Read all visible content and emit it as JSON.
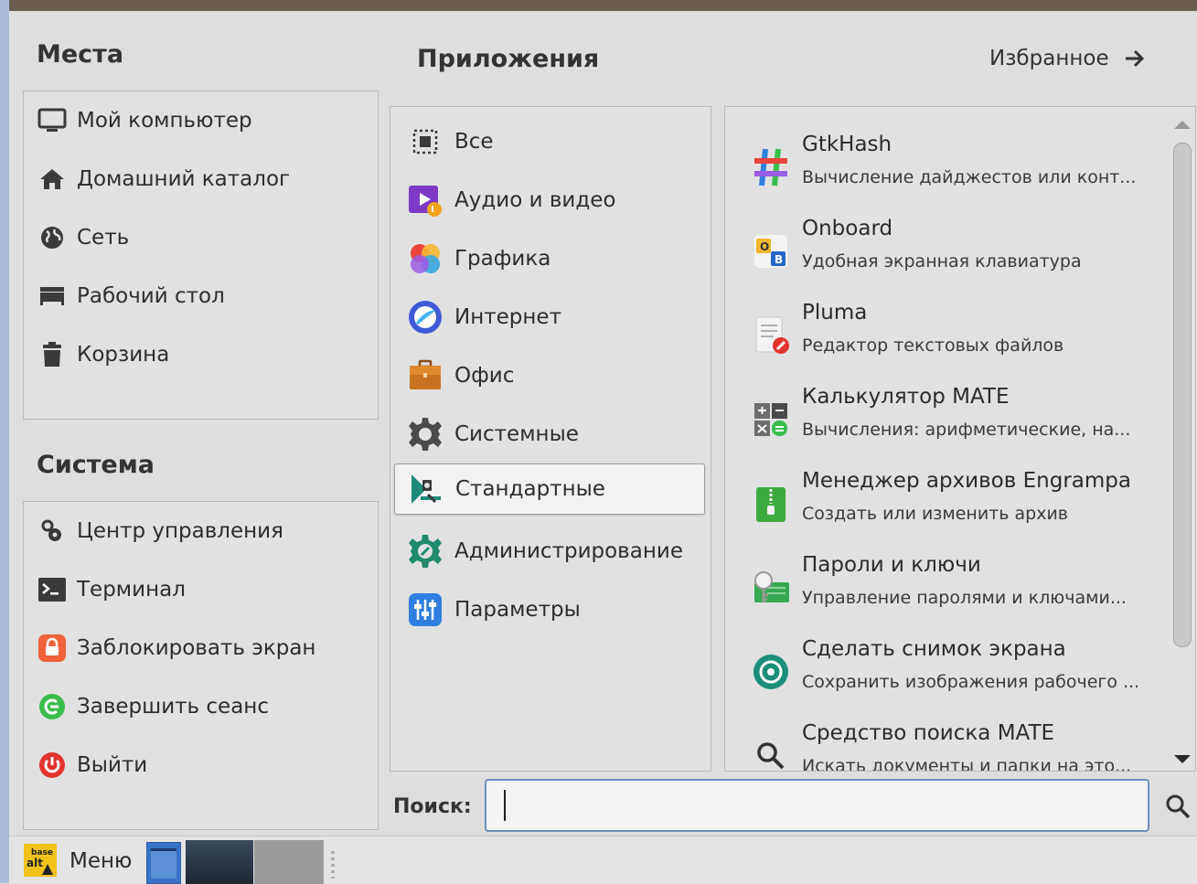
{
  "places": {
    "title": "Места",
    "items": [
      {
        "label": "Мой компьютер",
        "icon": "computer-icon"
      },
      {
        "label": "Домашний каталог",
        "icon": "home-icon"
      },
      {
        "label": "Сеть",
        "icon": "network-icon"
      },
      {
        "label": "Рабочий стол",
        "icon": "desktop-icon"
      },
      {
        "label": "Корзина",
        "icon": "trash-icon"
      }
    ]
  },
  "system": {
    "title": "Система",
    "items": [
      {
        "label": "Центр управления",
        "icon": "control-center-icon"
      },
      {
        "label": "Терминал",
        "icon": "terminal-icon"
      },
      {
        "label": "Заблокировать экран",
        "icon": "lock-icon"
      },
      {
        "label": "Завершить сеанс",
        "icon": "logout-icon"
      },
      {
        "label": "Выйти",
        "icon": "power-icon"
      }
    ]
  },
  "applications": {
    "title": "Приложения",
    "favorites_label": "Избранное",
    "selected_category": "Стандартные",
    "categories": [
      {
        "label": "Все",
        "icon": "all-grid-icon"
      },
      {
        "label": "Аудио и видео",
        "icon": "multimedia-icon"
      },
      {
        "label": "Графика",
        "icon": "graphics-icon"
      },
      {
        "label": "Интернет",
        "icon": "internet-icon"
      },
      {
        "label": "Офис",
        "icon": "office-icon"
      },
      {
        "label": "Системные",
        "icon": "system-gear-icon"
      },
      {
        "label": "Стандартные",
        "icon": "accessories-icon"
      },
      {
        "label": "Администрирование",
        "icon": "administration-icon"
      },
      {
        "label": "Параметры",
        "icon": "preferences-icon"
      }
    ],
    "apps": [
      {
        "name": "GtkHash",
        "desc": "Вычисление дайджестов или конт...",
        "icon": "gtkhash-icon"
      },
      {
        "name": "Onboard",
        "desc": "Удобная экранная клавиатура",
        "icon": "onboard-icon"
      },
      {
        "name": "Pluma",
        "desc": "Редактор текстовых файлов",
        "icon": "pluma-icon"
      },
      {
        "name": "Калькулятор MATE",
        "desc": "Вычисления: арифметические, на...",
        "icon": "calculator-icon"
      },
      {
        "name": "Менеджер архивов Engrampa",
        "desc": "Создать или изменить архив",
        "icon": "archive-icon"
      },
      {
        "name": "Пароли и ключи",
        "desc": "Управление паролями и ключами...",
        "icon": "passwords-keys-icon"
      },
      {
        "name": "Сделать снимок экрана",
        "desc": "Сохранить изображения рабочего ...",
        "icon": "screenshot-icon"
      },
      {
        "name": "Средство поиска MATE",
        "desc": "Искать документы и папки на это...",
        "icon": "search-tool-icon"
      }
    ]
  },
  "search": {
    "label": "Поиск:",
    "value": "",
    "placeholder": ""
  },
  "taskbar": {
    "menu_label": "Меню",
    "logo_text_top": "base",
    "logo_text_bottom": "alt"
  }
}
